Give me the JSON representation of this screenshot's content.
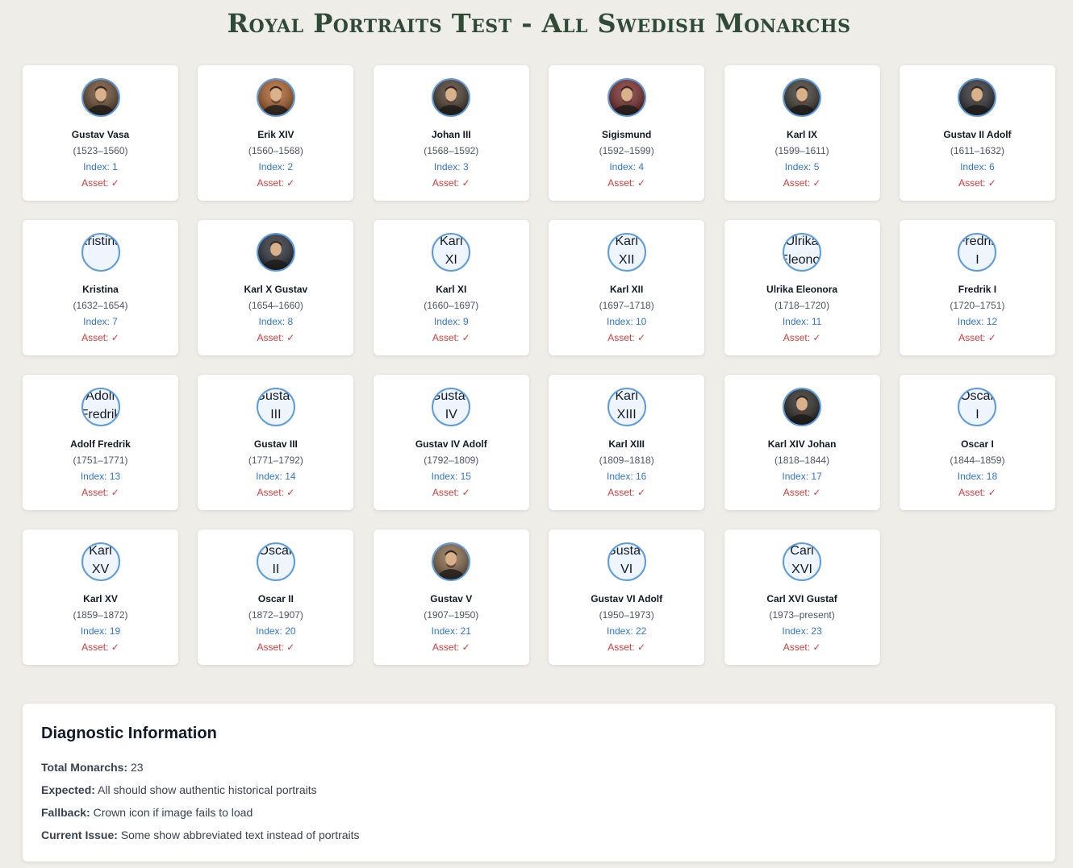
{
  "title": "Royal Portraits Test - All Swedish Monarchs",
  "monarchs": [
    {
      "name": "Gustav Vasa",
      "years": "(1523–1560)",
      "index": "Index: 1",
      "asset": "Asset: ✓",
      "portrait": "image",
      "abbr": "",
      "tone": "#6b4a2e"
    },
    {
      "name": "Erik XIV",
      "years": "(1560–1568)",
      "index": "Index: 2",
      "asset": "Asset: ✓",
      "portrait": "image",
      "abbr": "",
      "tone": "#b0622a"
    },
    {
      "name": "Johan III",
      "years": "(1568–1592)",
      "index": "Index: 3",
      "asset": "Asset: ✓",
      "portrait": "image",
      "abbr": "",
      "tone": "#4a3a2a"
    },
    {
      "name": "Sigismund",
      "years": "(1592–1599)",
      "index": "Index: 4",
      "asset": "Asset: ✓",
      "portrait": "image",
      "abbr": "",
      "tone": "#7a2a2a"
    },
    {
      "name": "Karl IX",
      "years": "(1599–1611)",
      "index": "Index: 5",
      "asset": "Asset: ✓",
      "portrait": "image",
      "abbr": "",
      "tone": "#3e3a33"
    },
    {
      "name": "Gustav II Adolf",
      "years": "(1611–1632)",
      "index": "Index: 6",
      "asset": "Asset: ✓",
      "portrait": "image",
      "abbr": "",
      "tone": "#2f2f35"
    },
    {
      "name": "Kristina",
      "years": "(1632–1654)",
      "index": "Index: 7",
      "asset": "Asset: ✓",
      "portrait": "fallback",
      "abbr": "Kristina",
      "tone": ""
    },
    {
      "name": "Karl X Gustav",
      "years": "(1654–1660)",
      "index": "Index: 8",
      "asset": "Asset: ✓",
      "portrait": "image",
      "abbr": "",
      "tone": "#2c2f3a"
    },
    {
      "name": "Karl XI",
      "years": "(1660–1697)",
      "index": "Index: 9",
      "asset": "Asset: ✓",
      "portrait": "fallback",
      "abbr": "Karl XI",
      "tone": ""
    },
    {
      "name": "Karl XII",
      "years": "(1697–1718)",
      "index": "Index: 10",
      "asset": "Asset: ✓",
      "portrait": "fallback",
      "abbr": "Karl XII",
      "tone": ""
    },
    {
      "name": "Ulrika Eleonora",
      "years": "(1718–1720)",
      "index": "Index: 11",
      "asset": "Asset: ✓",
      "portrait": "fallback",
      "abbr": "Ulrika Eleonora",
      "tone": ""
    },
    {
      "name": "Fredrik I",
      "years": "(1720–1751)",
      "index": "Index: 12",
      "asset": "Asset: ✓",
      "portrait": "fallback",
      "abbr": "Fredrik I",
      "tone": ""
    },
    {
      "name": "Adolf Fredrik",
      "years": "(1751–1771)",
      "index": "Index: 13",
      "asset": "Asset: ✓",
      "portrait": "fallback",
      "abbr": "Adolf Fredrik",
      "tone": ""
    },
    {
      "name": "Gustav III",
      "years": "(1771–1792)",
      "index": "Index: 14",
      "asset": "Asset: ✓",
      "portrait": "fallback",
      "abbr": "Gustav III",
      "tone": ""
    },
    {
      "name": "Gustav IV Adolf",
      "years": "(1792–1809)",
      "index": "Index: 15",
      "asset": "Asset: ✓",
      "portrait": "fallback",
      "abbr": "Gustav IV",
      "tone": ""
    },
    {
      "name": "Karl XIII",
      "years": "(1809–1818)",
      "index": "Index: 16",
      "asset": "Asset: ✓",
      "portrait": "fallback",
      "abbr": "Karl XIII",
      "tone": ""
    },
    {
      "name": "Karl XIV Johan",
      "years": "(1818–1844)",
      "index": "Index: 17",
      "asset": "Asset: ✓",
      "portrait": "image",
      "abbr": "",
      "tone": "#2a2824"
    },
    {
      "name": "Oscar I",
      "years": "(1844–1859)",
      "index": "Index: 18",
      "asset": "Asset: ✓",
      "portrait": "fallback",
      "abbr": "Oscar I",
      "tone": ""
    },
    {
      "name": "Karl XV",
      "years": "(1859–1872)",
      "index": "Index: 19",
      "asset": "Asset: ✓",
      "portrait": "fallback",
      "abbr": "Karl XV",
      "tone": ""
    },
    {
      "name": "Oscar II",
      "years": "(1872–1907)",
      "index": "Index: 20",
      "asset": "Asset: ✓",
      "portrait": "fallback",
      "abbr": "Oscar II",
      "tone": ""
    },
    {
      "name": "Gustav V",
      "years": "(1907–1950)",
      "index": "Index: 21",
      "asset": "Asset: ✓",
      "portrait": "image",
      "abbr": "",
      "tone": "#8a6a4a"
    },
    {
      "name": "Gustav VI Adolf",
      "years": "(1950–1973)",
      "index": "Index: 22",
      "asset": "Asset: ✓",
      "portrait": "fallback",
      "abbr": "Gustav VI",
      "tone": ""
    },
    {
      "name": "Carl XVI Gustaf",
      "years": "(1973–present)",
      "index": "Index: 23",
      "asset": "Asset: ✓",
      "portrait": "fallback",
      "abbr": "Carl XVI",
      "tone": ""
    }
  ],
  "diagnostics": {
    "heading": "Diagnostic Information",
    "total_label": "Total Monarchs:",
    "total_value": "23",
    "expected_label": "Expected:",
    "expected_value": "All should show authentic historical portraits",
    "fallback_label": "Fallback:",
    "fallback_value": "Crown icon if image fails to load",
    "issue_label": "Current Issue:",
    "issue_value": "Some show abbreviated text instead of portraits"
  }
}
